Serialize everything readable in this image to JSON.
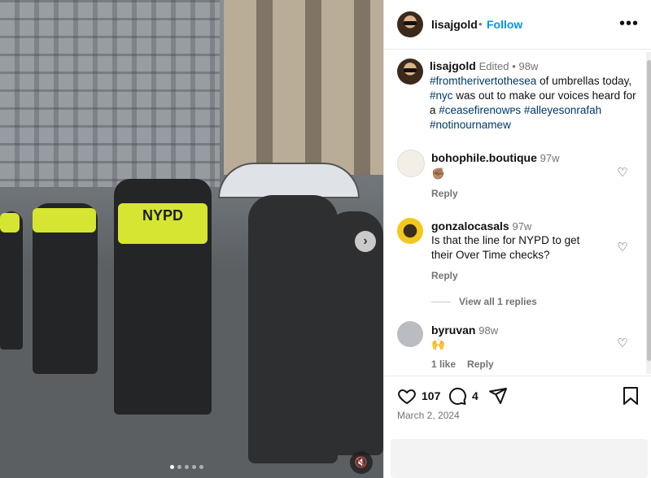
{
  "post": {
    "username": "lisajgold",
    "follow_label": "Follow",
    "separator": "•",
    "more_icon": "more-horizontal-icon",
    "caption": {
      "username": "lisajgold",
      "edited": "Edited",
      "time": "98w",
      "parts": [
        {
          "text": "#fromtherivertothesea",
          "tag": true
        },
        {
          "text": " of umbrellas today, ",
          "tag": false
        },
        {
          "text": "#nyc",
          "tag": true
        },
        {
          "text": " was out to make our voices heard for a ",
          "tag": false
        },
        {
          "text": "#ceasefirenowᴘs",
          "tag": true
        },
        {
          "text": " ",
          "tag": false
        },
        {
          "text": "#alleyesonrafah",
          "tag": true
        },
        {
          "text": " ",
          "tag": false
        },
        {
          "text": "#notinournamew",
          "tag": true
        }
      ]
    },
    "comments": [
      {
        "username": "bohophile.boutique",
        "time": "97w",
        "text": "✊🏽",
        "reply_label": "Reply"
      },
      {
        "username": "gonzalocasals",
        "time": "97w",
        "text": "Is that the line for NYPD to get their Over Time checks?",
        "reply_label": "Reply",
        "view_replies": "View all 1 replies"
      },
      {
        "username": "byruvan",
        "time": "98w",
        "text": "🙌",
        "likes": "1 like",
        "reply_label": "Reply"
      }
    ],
    "likes_count": "107",
    "comments_count": "4",
    "date": "March 2, 2024",
    "media": {
      "carousel_dots": 5,
      "active_dot": 0,
      "next_icon": "chevron-right-icon",
      "mute_icon": "speaker-muted-icon",
      "vest_label": "NYPD"
    }
  },
  "colors": {
    "link": "#0095f6",
    "hashtag": "#00376b",
    "muted": "#737373"
  }
}
